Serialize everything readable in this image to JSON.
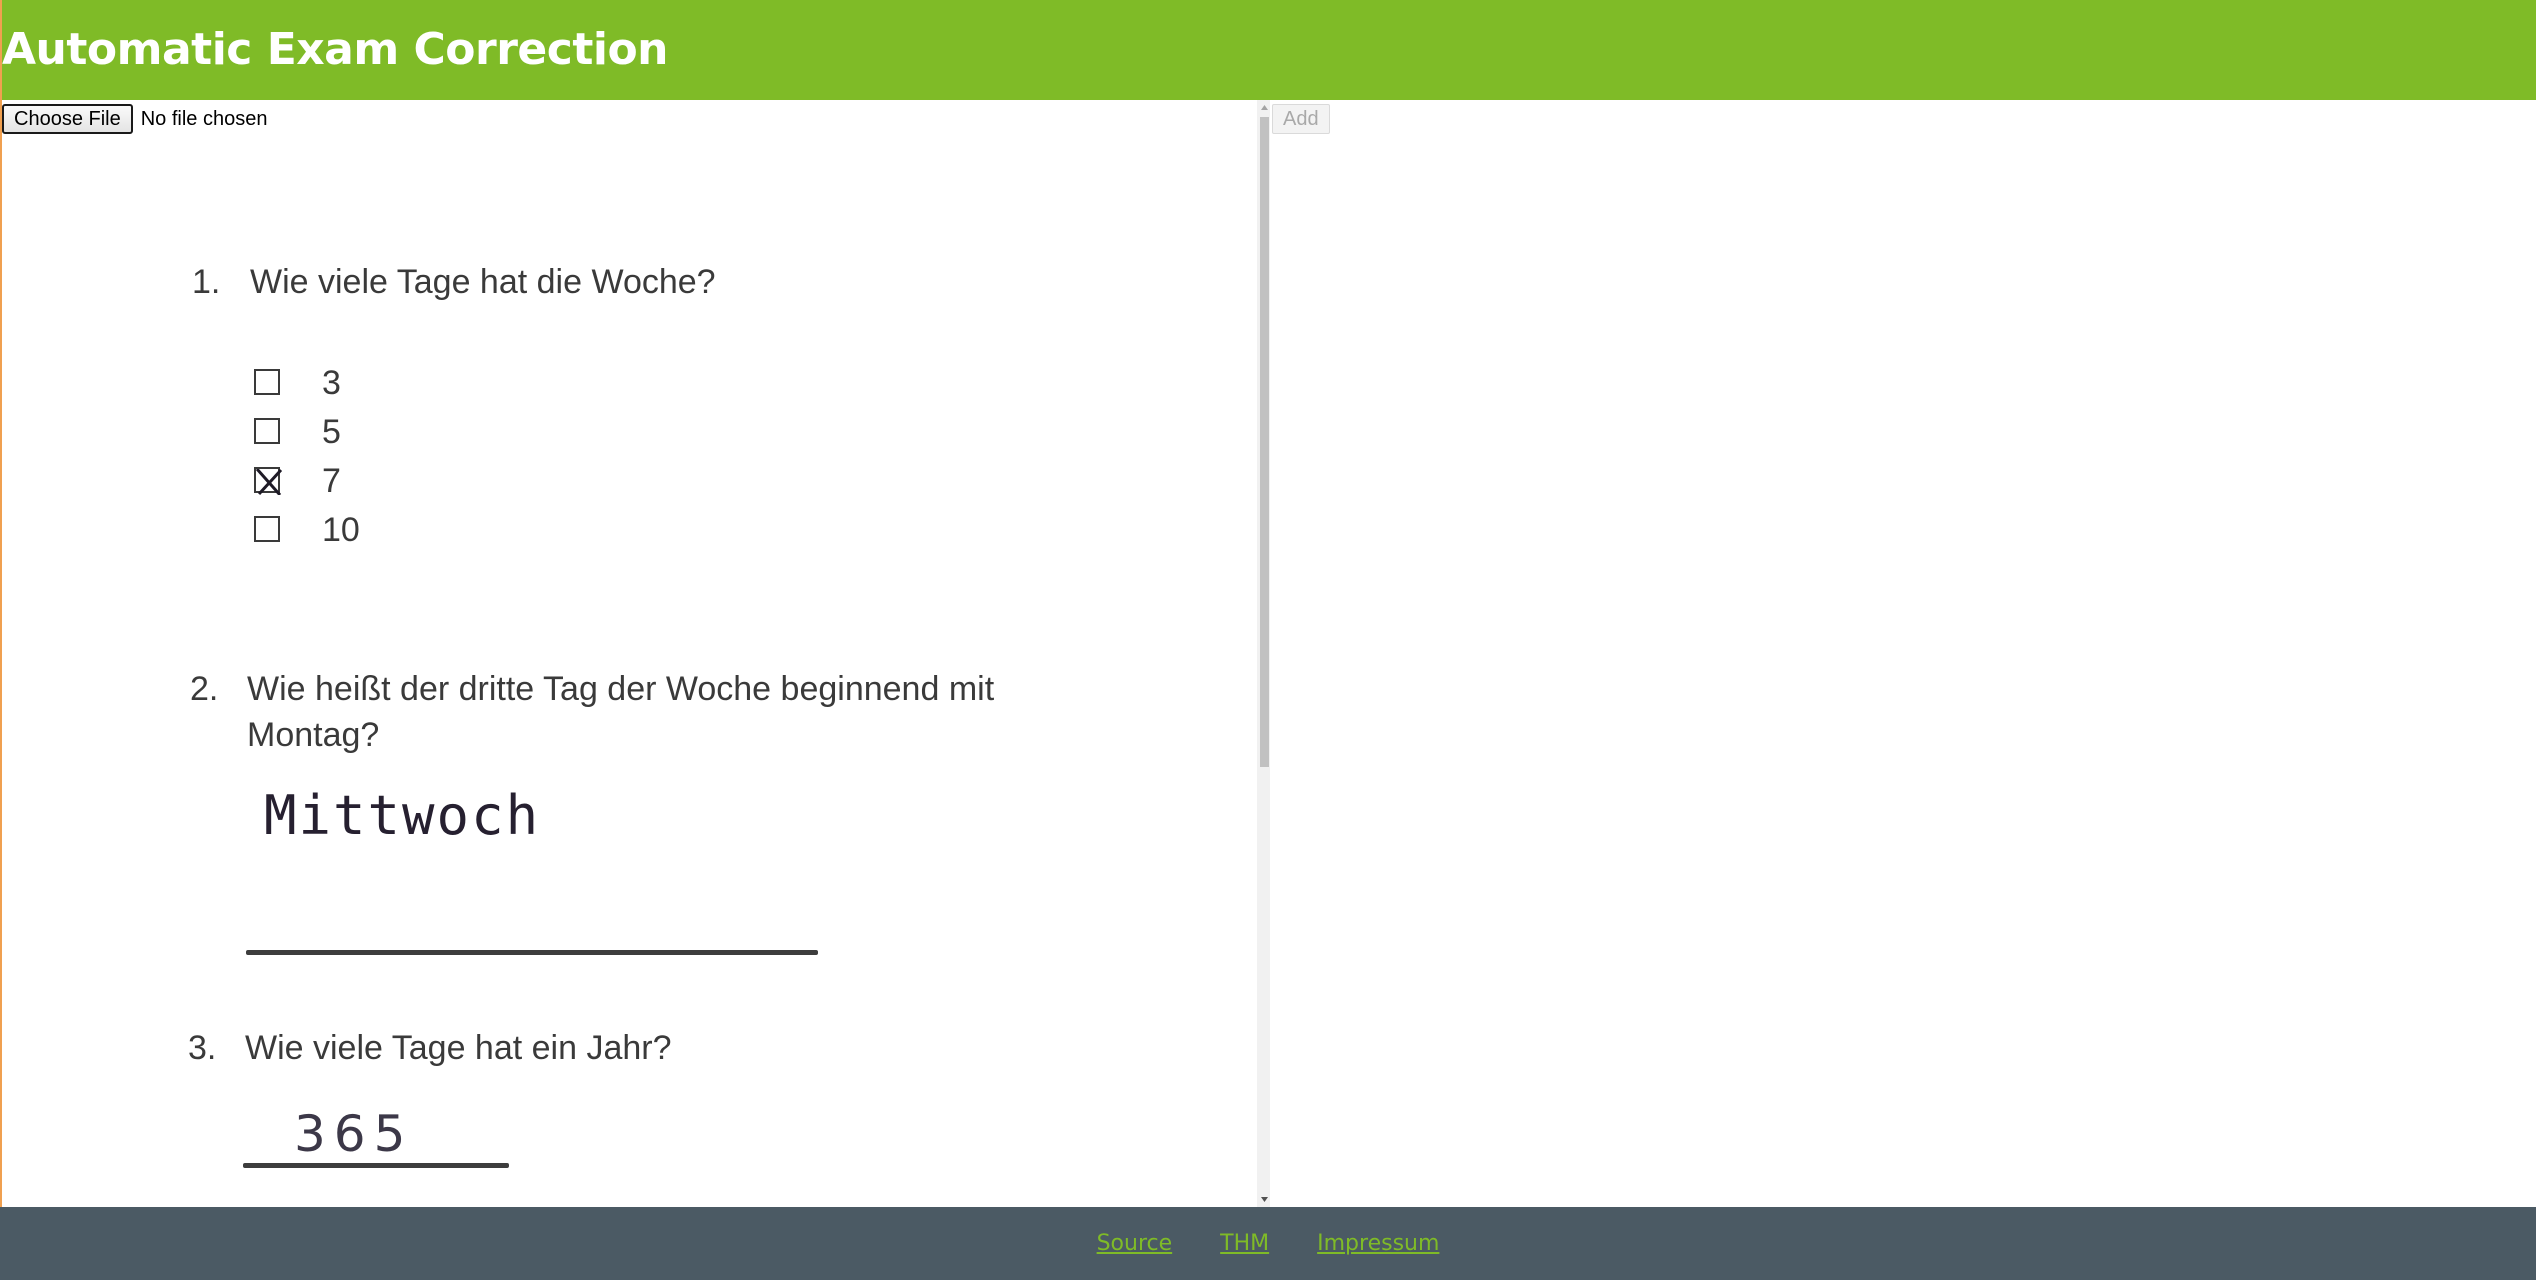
{
  "app": {
    "title": "Automatic Exam Correction"
  },
  "file_input": {
    "button_label": "Choose File",
    "status": "No file chosen"
  },
  "toolbar": {
    "add_label": "Add"
  },
  "exam": {
    "q1": {
      "number": "1.",
      "text": "Wie viele Tage hat die Woche?",
      "options": [
        {
          "label": "3",
          "checked": false
        },
        {
          "label": "5",
          "checked": false
        },
        {
          "label": "7",
          "checked": true
        },
        {
          "label": "10",
          "checked": false
        }
      ]
    },
    "q2": {
      "number": "2.",
      "text_line1": "Wie heißt der dritte Tag der Woche beginnend mit",
      "text_line2": "Montag?",
      "handwritten_answer": "Mittwoch"
    },
    "q3": {
      "number": "3.",
      "text": "Wie viele Tage hat ein Jahr?",
      "handwritten_answer": "365"
    }
  },
  "footer": {
    "links": [
      "Source",
      "THM",
      "Impressum"
    ]
  },
  "colors": {
    "header": "#7fbb27",
    "footer": "#4b5a64",
    "link": "#7fbb27"
  }
}
